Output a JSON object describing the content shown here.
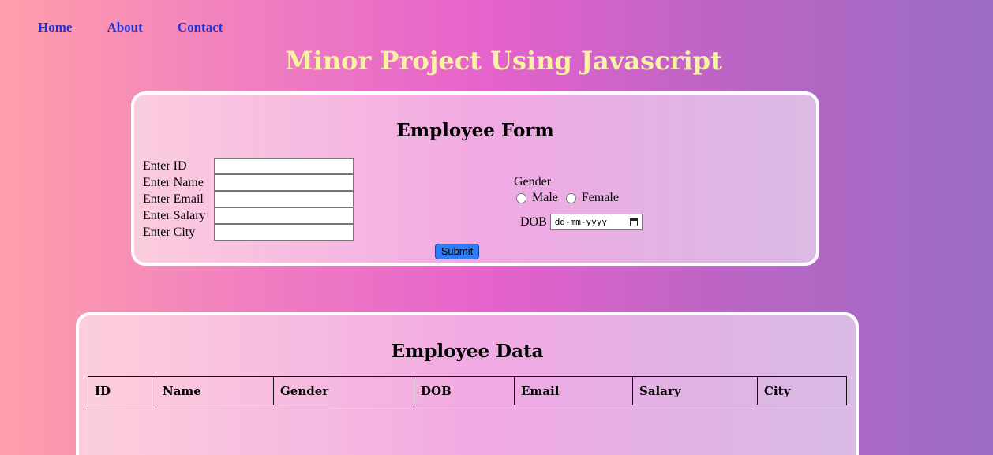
{
  "nav": {
    "items": [
      {
        "label": "Home"
      },
      {
        "label": "About"
      },
      {
        "label": "Contact"
      }
    ]
  },
  "page": {
    "title": "Minor Project Using Javascript"
  },
  "form": {
    "title": "Employee Form",
    "fields": {
      "id": {
        "label": "Enter ID",
        "value": ""
      },
      "name": {
        "label": "Enter Name",
        "value": ""
      },
      "email": {
        "label": "Enter Email",
        "value": ""
      },
      "salary": {
        "label": "Enter Salary",
        "value": ""
      },
      "city": {
        "label": "Enter City",
        "value": ""
      }
    },
    "gender": {
      "label": "Gender",
      "options": [
        "Male",
        "Female"
      ]
    },
    "dob": {
      "label": "DOB",
      "placeholder": "dd-mm-yyyy"
    },
    "submit_label": "Submit"
  },
  "table": {
    "title": "Employee Data",
    "columns": [
      "ID",
      "Name",
      "Gender",
      "DOB",
      "Email",
      "Salary",
      "City"
    ]
  },
  "colors": {
    "nav_link": "#2134d6",
    "title": "#f7f3a2",
    "submit_button": "#2f7df6"
  }
}
